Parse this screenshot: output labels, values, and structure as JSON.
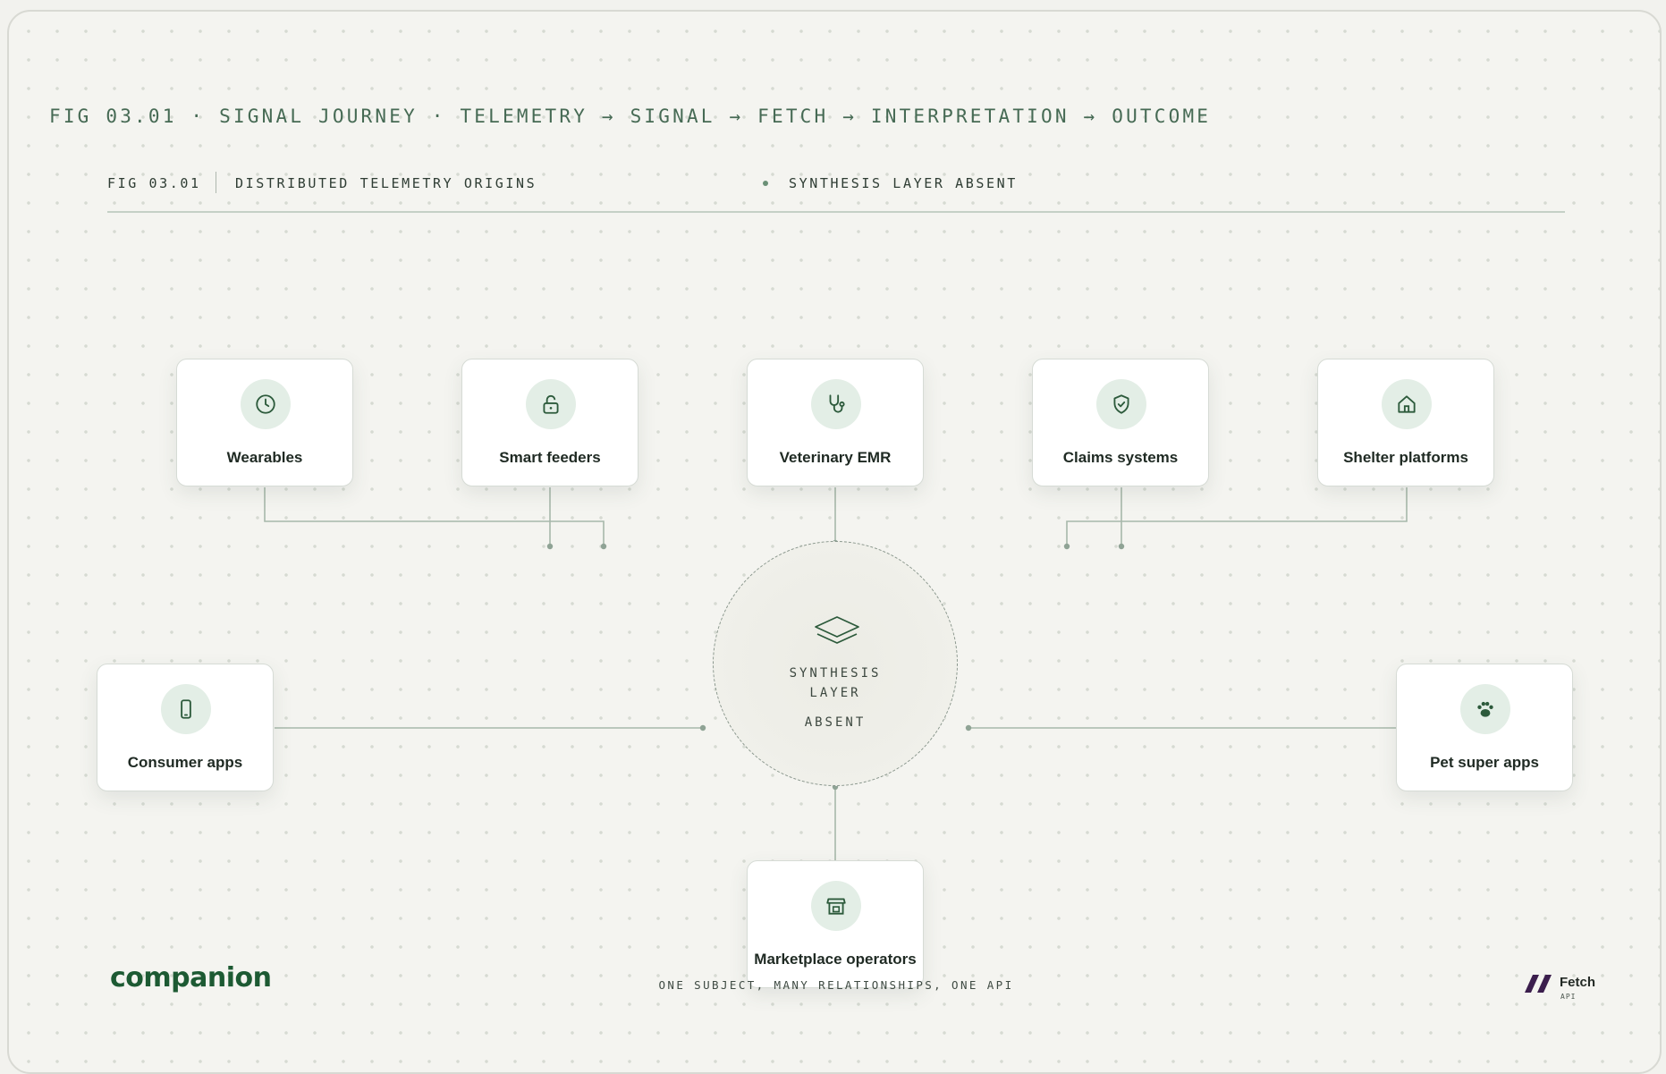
{
  "figure": {
    "title": "FIG 03.01 · SIGNAL JOURNEY · TELEMETRY → SIGNAL → FETCH → INTERPRETATION → OUTCOME"
  },
  "panel": {
    "code": "FIG 03.01",
    "description": "DISTRIBUTED TELEMETRY ORIGINS",
    "status": "SYNTHESIS LAYER ABSENT"
  },
  "nodes": {
    "wearables": {
      "label": "Wearables",
      "icon": "clock-icon"
    },
    "smart_feeders": {
      "label": "Smart feeders",
      "icon": "lock-open-icon"
    },
    "veterinary_emr": {
      "label": "Veterinary EMR",
      "icon": "stethoscope-icon"
    },
    "claims_systems": {
      "label": "Claims systems",
      "icon": "shield-check-icon"
    },
    "shelter_platforms": {
      "label": "Shelter platforms",
      "icon": "house-icon"
    },
    "consumer_apps": {
      "label": "Consumer apps",
      "icon": "smartphone-icon"
    },
    "pet_super_apps": {
      "label": "Pet super apps",
      "icon": "paw-icon"
    },
    "marketplace_operators": {
      "label": "Marketplace operators",
      "icon": "storefront-icon"
    }
  },
  "hub": {
    "line1": "SYNTHESIS",
    "line2": "LAYER",
    "line3": "ABSENT",
    "icon": "layers-icon"
  },
  "footer": {
    "brand_left": "companion",
    "tagline": "ONE SUBJECT, MANY RELATIONSHIPS, ONE API",
    "brand_right_name": "Fetch",
    "brand_right_sub": "API"
  },
  "colors": {
    "accent_green": "#1d5a33",
    "icon_bg": "#e3eee6",
    "connector": "#a7b8aa"
  }
}
